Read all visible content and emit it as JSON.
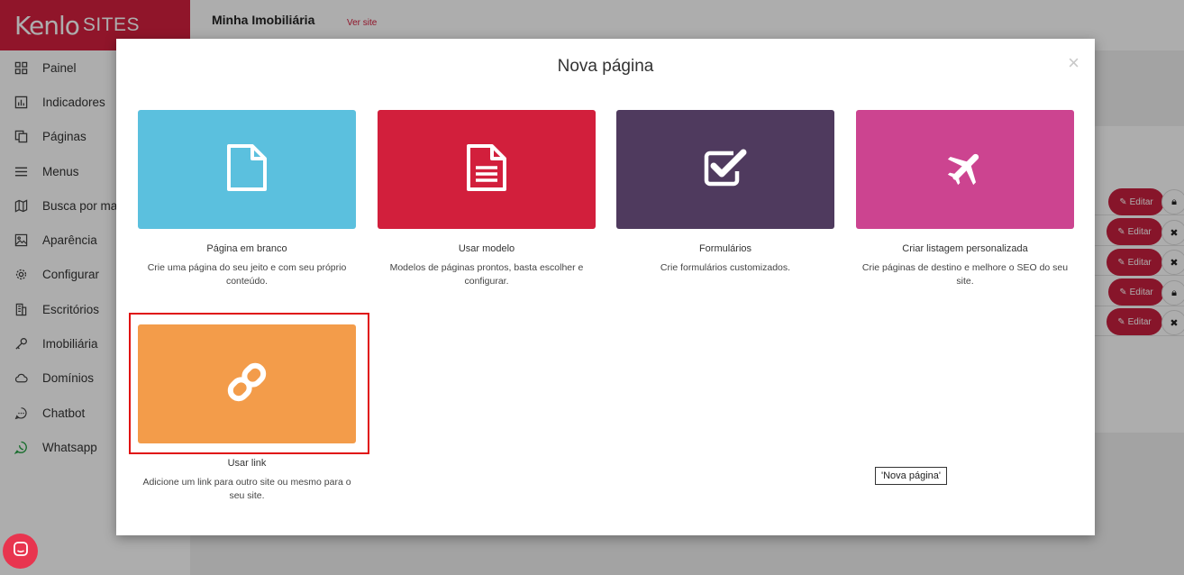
{
  "brand": {
    "logo": "Kenlo",
    "product": "SITES",
    "color": "#d4203f"
  },
  "header": {
    "site_name": "Minha Imobiliária",
    "view_site": "Ver site"
  },
  "sidebar": {
    "items": [
      {
        "label": "Painel",
        "icon": "grid-icon"
      },
      {
        "label": "Indicadores",
        "icon": "bar-chart-icon"
      },
      {
        "label": "Páginas",
        "icon": "pages-icon"
      },
      {
        "label": "Menus",
        "icon": "menu-icon"
      },
      {
        "label": "Busca por mapa",
        "icon": "map-icon"
      },
      {
        "label": "Aparência",
        "icon": "image-icon"
      },
      {
        "label": "Configurar",
        "icon": "gear-icon"
      },
      {
        "label": "Escritórios",
        "icon": "building-icon"
      },
      {
        "label": "Imobiliária",
        "icon": "key-icon"
      },
      {
        "label": "Domínios",
        "icon": "cloud-icon"
      },
      {
        "label": "Chatbot",
        "icon": "chat-icon"
      },
      {
        "label": "Whatsapp",
        "icon": "whatsapp-icon"
      }
    ]
  },
  "background_rows": {
    "edit_label": "Editar",
    "rows": [
      {
        "side": "lock"
      },
      {
        "side": "close"
      },
      {
        "side": "close"
      },
      {
        "side": "lock"
      },
      {
        "side": "close"
      }
    ]
  },
  "modal": {
    "title": "Nova página",
    "close": "×",
    "cards": [
      {
        "title": "Página em branco",
        "desc": "Crie uma página do seu jeito e com seu próprio conteúdo.",
        "color": "#5bc0de",
        "icon": "blank-file-icon"
      },
      {
        "title": "Usar modelo",
        "desc": "Modelos de páginas prontos, basta escolher e configurar.",
        "color": "#d21f3c",
        "icon": "document-icon"
      },
      {
        "title": "Formulários",
        "desc": "Crie formulários customizados.",
        "color": "#4f3a5e",
        "icon": "checkbox-icon"
      },
      {
        "title": "Criar listagem personalizada",
        "desc": "Crie páginas de destino e melhore o SEO do seu site.",
        "color": "#cc4490",
        "icon": "plane-icon"
      },
      {
        "title": "Usar link",
        "desc": "Adicione um link para outro site ou mesmo para o seu site.",
        "color": "#f39c4a",
        "icon": "link-icon"
      }
    ]
  },
  "tooltip": "'Nova página'"
}
